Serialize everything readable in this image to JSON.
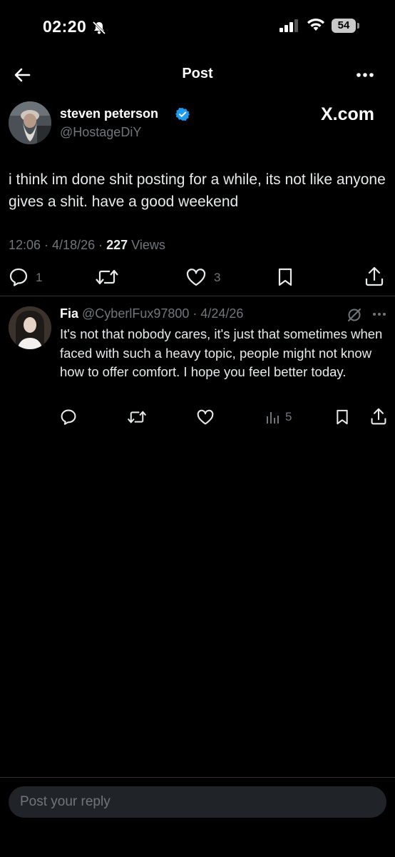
{
  "status_bar": {
    "time": "02:20",
    "battery": "54"
  },
  "header": {
    "title": "Post"
  },
  "post": {
    "author_name": "steven peterson",
    "author_handle": "@HostageDiY",
    "source_label": "X.com",
    "text": "i think im done shit posting for a while, its not like anyone gives a shit. have a good weekend",
    "time": "12:06",
    "date": "4/18/26",
    "views_count": "227",
    "views_label": "Views",
    "replies": "1",
    "likes": "3"
  },
  "reply": {
    "name": "Fia",
    "handle": "@CyberlFux97800",
    "date": "4/24/26",
    "text": "It's not that nobody cares, it's just that sometimes when faced with such a heavy topic, people might not know how to offer comfort. I hope you feel better today.",
    "views": "5"
  },
  "composer": {
    "placeholder": "Post your reply"
  },
  "colors": {
    "background": "#000000",
    "text": "#e7e9ea",
    "muted": "#71767b",
    "verified": "#1d9bf0",
    "divider": "#2f3336"
  },
  "icons": [
    "bell-slash-icon",
    "signal-icon",
    "wifi-icon",
    "back-arrow-icon",
    "more-icon",
    "verified-badge-icon",
    "reply-icon",
    "retweet-icon",
    "like-icon",
    "bookmark-icon",
    "share-icon",
    "grok-icon",
    "views-icon"
  ]
}
